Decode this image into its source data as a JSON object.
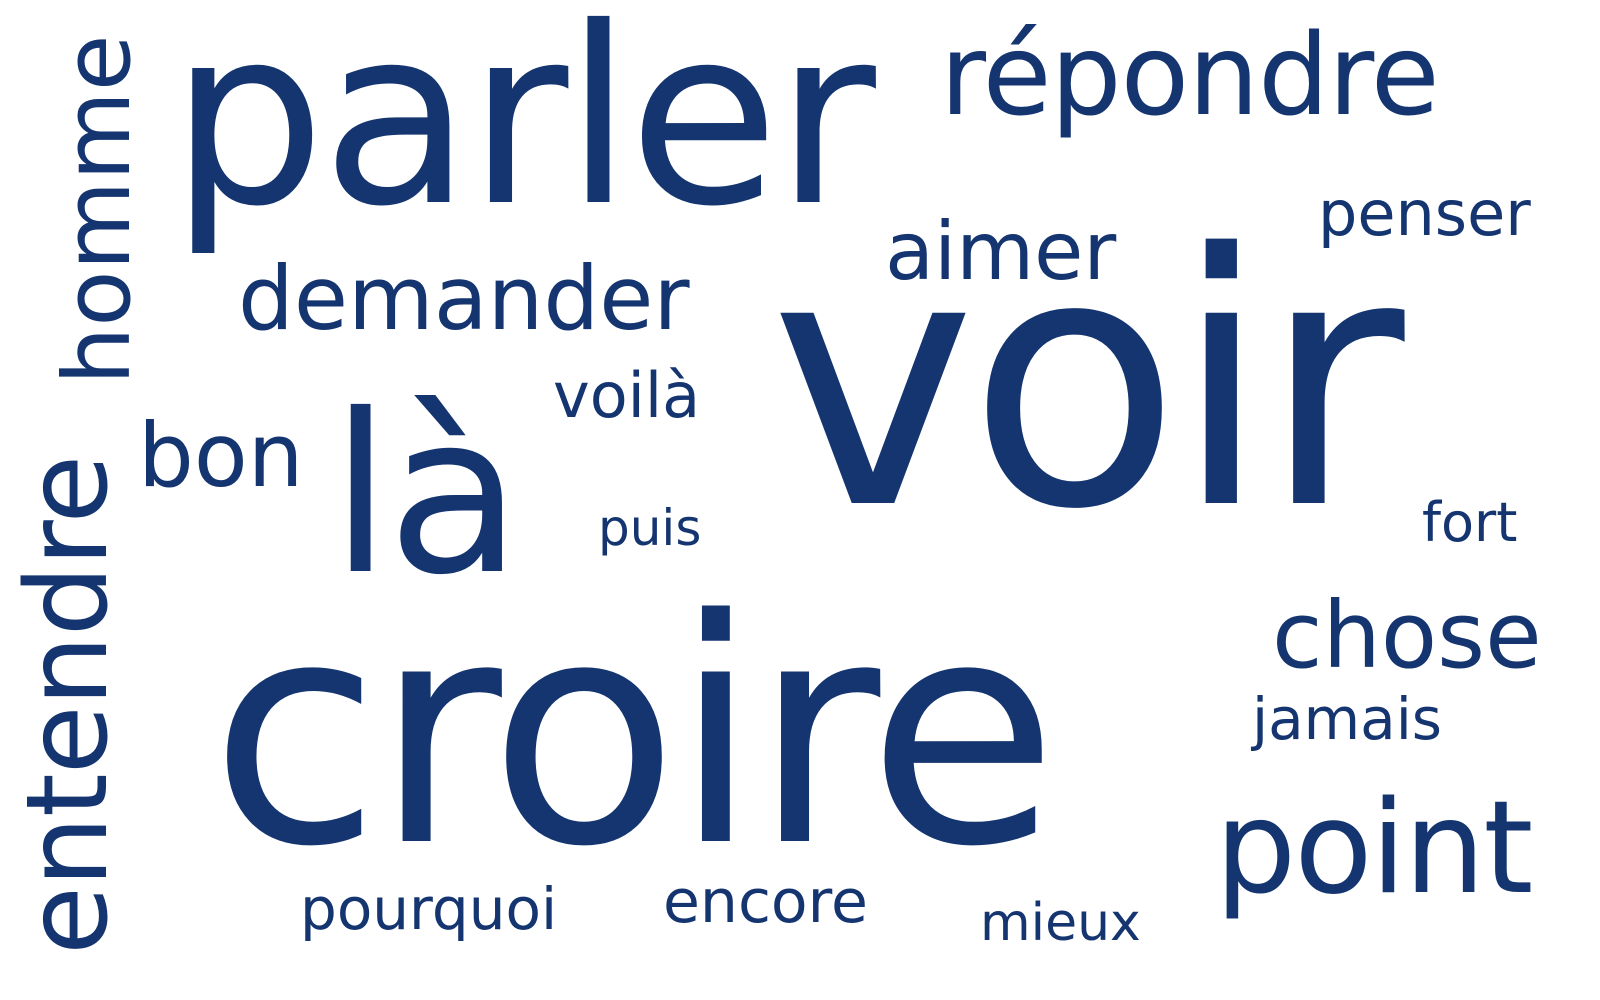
{
  "colors": {
    "text": "#153570",
    "background": "#ffffff"
  },
  "words": {
    "voir": "voir",
    "croire": "croire",
    "parler": "parler",
    "la": "là",
    "repondre": "répondre",
    "point": "point",
    "chose": "chose",
    "demander": "demander",
    "bon": "bon",
    "aimer": "aimer",
    "penser": "penser",
    "jamais": "jamais",
    "voila": "voilà",
    "puis": "puis",
    "fort": "fort",
    "pourquoi": "pourquoi",
    "encore": "encore",
    "mieux": "mieux",
    "homme": "homme",
    "entendre": "entendre"
  }
}
